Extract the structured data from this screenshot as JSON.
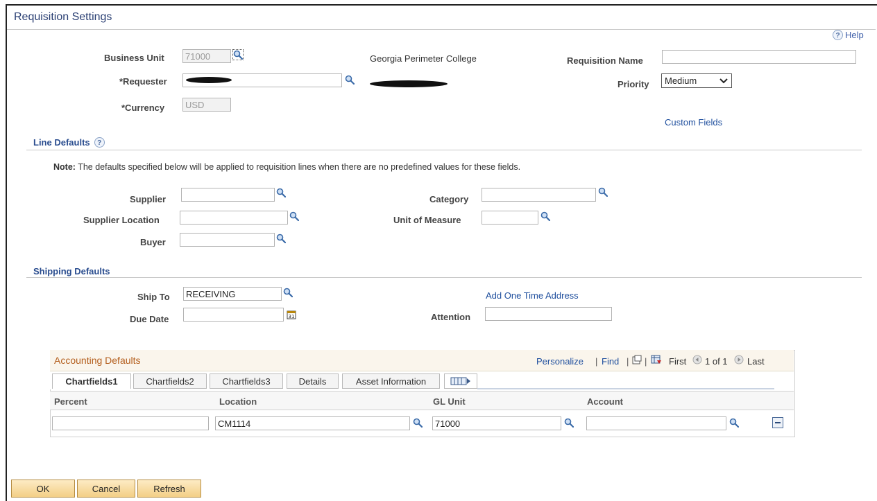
{
  "page": {
    "title": "Requisition Settings",
    "help": "Help"
  },
  "header": {
    "business_unit": {
      "label": "Business Unit",
      "value": "71000"
    },
    "college": "Georgia Perimeter College",
    "requisition_name": {
      "label": "Requisition Name",
      "value": ""
    },
    "requester": {
      "label": "*Requester"
    },
    "priority": {
      "label": "Priority",
      "value": "Medium"
    },
    "currency": {
      "label": "*Currency",
      "value": "USD"
    },
    "custom_fields": "Custom Fields"
  },
  "line_defaults": {
    "title": "Line Defaults",
    "note_bold": "Note:",
    "note_text": " The defaults specified below will be applied to requisition lines when there are no predefined values for these fields.",
    "supplier": "Supplier",
    "supplier_location": "Supplier Location",
    "buyer": "Buyer",
    "category": "Category",
    "unit_of_measure": "Unit of Measure"
  },
  "shipping_defaults": {
    "title": "Shipping Defaults",
    "ship_to": {
      "label": "Ship To",
      "value": "RECEIVING"
    },
    "add_address": "Add One Time Address",
    "due_date": "Due Date",
    "attention": "Attention"
  },
  "accounting": {
    "title": "Accounting Defaults",
    "nav": {
      "personalize": "Personalize",
      "sep1": "|",
      "find": "Find",
      "sep2": "|",
      "sep3": "|",
      "first": "First",
      "range": "1 of 1",
      "last": "Last"
    },
    "tabs": [
      "Chartfields1",
      "Chartfields2",
      "Chartfields3",
      "Details",
      "Asset Information"
    ],
    "columns": [
      "Percent",
      "Location",
      "GL Unit",
      "Account"
    ],
    "row": {
      "percent": "",
      "location": "CM1114",
      "gl_unit": "71000",
      "account": ""
    }
  },
  "buttons": {
    "ok": "OK",
    "cancel": "Cancel",
    "refresh": "Refresh"
  },
  "colors": {
    "title": "#2a3f73",
    "section": "#2a4d8f",
    "grid_title": "#b45f1e",
    "link": "#1f4f9e",
    "button": "#f3cf86"
  },
  "icons": [
    "help-icon",
    "search-icon",
    "calendar-icon",
    "chevron-down-icon",
    "previous-icon",
    "next-icon",
    "zoom-icon",
    "download-icon",
    "show-all-columns-icon",
    "delete-row-icon"
  ]
}
